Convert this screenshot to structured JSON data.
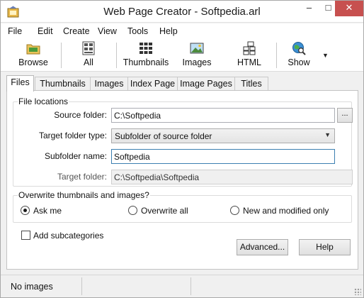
{
  "window": {
    "title": "Web Page Creator - Softpedia.arl",
    "icon": "app-icon",
    "controls": {
      "minimize": "–",
      "maximize": "□",
      "close": "✕"
    }
  },
  "menu": {
    "items": [
      {
        "label": "File"
      },
      {
        "label": "Edit"
      },
      {
        "label": "Create"
      },
      {
        "label": "View"
      },
      {
        "label": "Tools"
      },
      {
        "label": "Help"
      }
    ]
  },
  "toolbar": {
    "buttons": [
      {
        "label": "Browse",
        "icon": "folder-icon"
      },
      {
        "label": "All",
        "icon": "all-icon"
      },
      {
        "label": "Thumbnails",
        "icon": "thumbnails-icon"
      },
      {
        "label": "Images",
        "icon": "image-icon"
      },
      {
        "label": "HTML",
        "icon": "html-icon"
      },
      {
        "label": "Show",
        "icon": "globe-search-icon"
      }
    ],
    "dropdown_arrow": "▼"
  },
  "tabs": [
    {
      "label": "Files",
      "active": true
    },
    {
      "label": "Thumbnails",
      "active": false
    },
    {
      "label": "Images",
      "active": false
    },
    {
      "label": "Index Page",
      "active": false
    },
    {
      "label": "Image Pages",
      "active": false
    },
    {
      "label": "Titles",
      "active": false
    }
  ],
  "file_locations": {
    "title": "File locations",
    "source_folder_label": "Source folder:",
    "source_folder_value": "C:\\Softpedia",
    "browse_label": "...",
    "target_type_label": "Target folder type:",
    "target_type_value": "Subfolder of source folder",
    "subfolder_label": "Subfolder name:",
    "subfolder_value": "Softpedia",
    "target_folder_label": "Target folder:",
    "target_folder_value": "C:\\Softpedia\\Softpedia"
  },
  "overwrite": {
    "title": "Overwrite thumbnails and images?",
    "options": [
      {
        "label": "Ask me",
        "checked": true
      },
      {
        "label": "Overwrite all",
        "checked": false
      },
      {
        "label": "New and modified only",
        "checked": false
      }
    ]
  },
  "add_subcategories": {
    "label": "Add subcategories",
    "checked": false
  },
  "buttons": {
    "advanced": "Advanced...",
    "help": "Help"
  },
  "status": {
    "text": "No images"
  }
}
